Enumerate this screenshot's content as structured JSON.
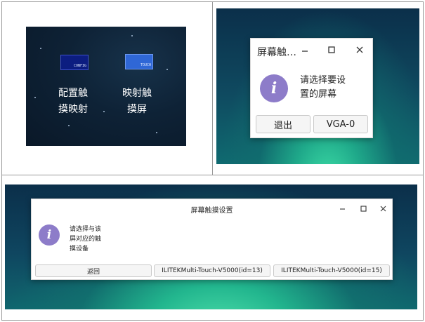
{
  "panel_config_desktop": {
    "icons": [
      {
        "label": "配置触摸映射",
        "icon_text": "CONFIG"
      },
      {
        "label": "映射触摸屏",
        "icon_text": "TOUCH"
      }
    ]
  },
  "dialog_select_screen": {
    "title": "屏幕触…",
    "message": "请选择要设置的屏幕",
    "buttons": {
      "exit": "退出",
      "vga": "VGA-0"
    }
  },
  "dialog_select_device": {
    "title": "屏幕触摸设置",
    "message": "请选择与该屏对应的触摸设备",
    "buttons": {
      "back": "返回",
      "device_1": "ILITEKMulti-Touch-V5000(id=13)",
      "device_2": "ILITEKMulti-Touch-V5000(id=15)"
    }
  },
  "icons": {
    "info": "info-icon",
    "minimize": "minimize-icon",
    "maximize": "maximize-icon",
    "close": "close-icon"
  },
  "colors": {
    "info_icon": "#8d7cc9",
    "config_icon": "#0c1d80",
    "touch_icon": "#2f67d6",
    "desktop_dark": "#0e2236",
    "desktop_teal": "#0f4a60"
  }
}
